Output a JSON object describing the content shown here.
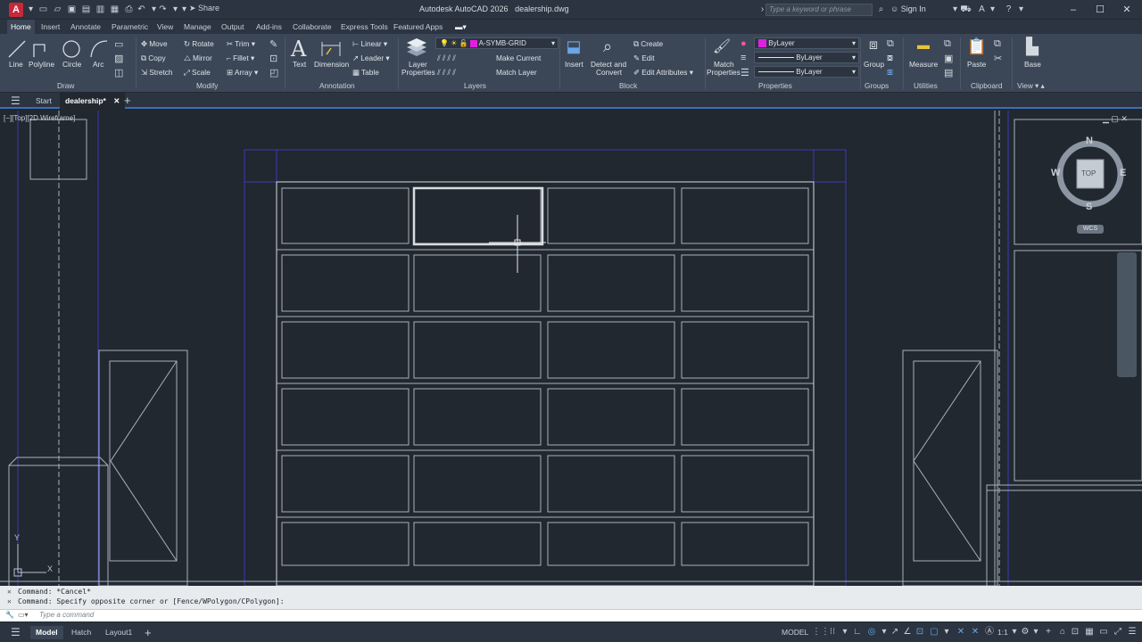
{
  "app": {
    "title": "Autodesk AutoCAD 2026",
    "filename": "dealership.dwg",
    "logo_letter": "A",
    "share_label": "Share",
    "search_placeholder": "Type a keyword or phrase",
    "signin_label": "Sign In"
  },
  "ribbon_tabs": [
    "Home",
    "Insert",
    "Annotate",
    "Parametric",
    "View",
    "Manage",
    "Output",
    "Add-ins",
    "Collaborate",
    "Express Tools",
    "Featured Apps"
  ],
  "ribbon": {
    "draw": {
      "title": "Draw",
      "tools": [
        "Line",
        "Polyline",
        "Circle",
        "Arc"
      ]
    },
    "modify": {
      "title": "Modify",
      "tools": [
        "Move",
        "Rotate",
        "Trim",
        "Copy",
        "Mirror",
        "Fillet",
        "Stretch",
        "Scale",
        "Array"
      ]
    },
    "annotation": {
      "title": "Annotation",
      "tools": [
        "Text",
        "Dimension",
        "Linear",
        "Leader",
        "Table"
      ]
    },
    "layers": {
      "title": "Layers",
      "big_label_1": "Layer",
      "big_label_2": "Properties",
      "current_layer": "A-SYMB-GRID",
      "layer_color": "#e020e0",
      "make_current": "Make Current",
      "match_layer": "Match Layer"
    },
    "block": {
      "title": "Block",
      "insert": "Insert",
      "detect_1": "Detect and",
      "detect_2": "Convert",
      "create": "Create",
      "edit": "Edit",
      "edit_attributes": "Edit Attributes"
    },
    "properties": {
      "title": "Properties",
      "match_1": "Match",
      "match_2": "Properties",
      "color": "ByLayer",
      "linetype": "ByLayer",
      "lineweight": "ByLayer"
    },
    "groups": {
      "title": "Groups",
      "group": "Group"
    },
    "utilities": {
      "title": "Utilities",
      "measure": "Measure"
    },
    "clipboard": {
      "title": "Clipboard",
      "paste": "Paste"
    },
    "view": {
      "title": "View",
      "base": "Base"
    }
  },
  "doc_tabs": {
    "start": "Start",
    "active": "dealership*"
  },
  "viewport": {
    "label": "[−][Top][2D Wireframe]"
  },
  "viewcube": {
    "north": "N",
    "south": "S",
    "east": "E",
    "west": "W",
    "face": "TOP",
    "wcs": "WCS"
  },
  "ucs": {
    "y": "Y",
    "x": "X"
  },
  "command": {
    "history_1": "Command: *Cancel*",
    "history_2": "Command: Specify opposite corner or [Fence/WPolygon/CPolygon]:",
    "placeholder": "Type a command"
  },
  "status": {
    "layout_tabs": [
      "Model",
      "Hatch",
      "Layout1"
    ],
    "model_label": "MODEL",
    "scale": "1:1"
  },
  "colors": {
    "accent_blue": "#3b6fb6",
    "drawing_line": "#a9b1ba",
    "blue_line": "#3a3ab8",
    "selection": "#d8dde2"
  }
}
